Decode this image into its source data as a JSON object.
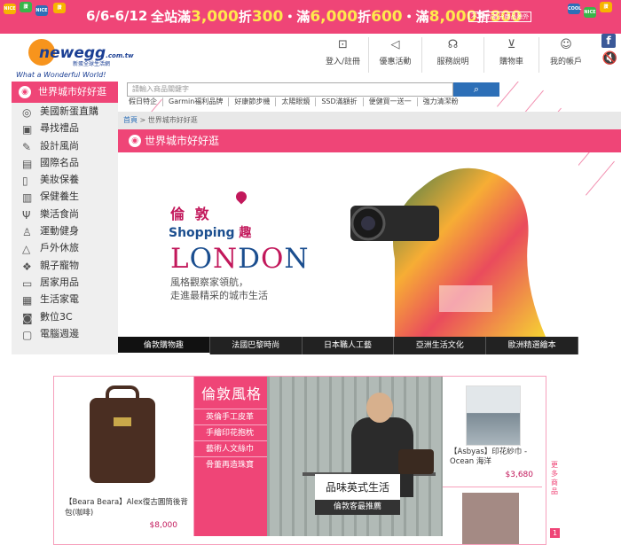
{
  "promo": {
    "dates": "6/6-6/12",
    "main_prefix_1": "全站滿",
    "amt1": "3,000",
    "off1_mid": "折",
    "off1": "300",
    "sep": "・滿",
    "amt2": "6,000",
    "off2_mid": "折",
    "off2": "600",
    "sep2": "・滿",
    "amt3": "8,000",
    "off3_mid": "折",
    "off3": "800",
    "note": "不累折/部分商品除外",
    "badges": [
      "NICE",
      "讚",
      "NICE",
      "讚",
      "COOL",
      "NICE",
      "讚"
    ]
  },
  "logo": {
    "text": "newegg",
    "domain": ".com.tw",
    "sub": "新蛋全球生活網",
    "slogan": "What a Wonderful World!"
  },
  "header_nav": [
    {
      "label": "登入/註冊",
      "icon": "login-icon",
      "glyph": "⊡"
    },
    {
      "label": "優惠活動",
      "icon": "megaphone-icon",
      "glyph": "◁"
    },
    {
      "label": "服務說明",
      "icon": "headset-icon",
      "glyph": "☊"
    },
    {
      "label": "購物車",
      "icon": "cart-icon",
      "glyph": "⊻"
    },
    {
      "label": "我的帳戶",
      "icon": "account-icon",
      "glyph": "☺"
    }
  ],
  "social": {
    "facebook": "f",
    "sound": "🔇"
  },
  "sidebar": {
    "header": "世界城市好好逛",
    "items": [
      {
        "label": "美國新蛋直購",
        "icon": "globe-icon",
        "glyph": "◎"
      },
      {
        "label": "尋找禮品",
        "icon": "gift-icon",
        "glyph": "▣"
      },
      {
        "label": "設計風尚",
        "icon": "pencil-icon",
        "glyph": "✎"
      },
      {
        "label": "國際名品",
        "icon": "badge-icon",
        "glyph": "▤"
      },
      {
        "label": "美妝保養",
        "icon": "cosmetics-icon",
        "glyph": "▯"
      },
      {
        "label": "保健養生",
        "icon": "health-icon",
        "glyph": "▥"
      },
      {
        "label": "樂活食尚",
        "icon": "fork-icon",
        "glyph": "Ψ"
      },
      {
        "label": "運動健身",
        "icon": "run-icon",
        "glyph": "♙"
      },
      {
        "label": "戶外休旅",
        "icon": "tent-icon",
        "glyph": "△"
      },
      {
        "label": "親子寵物",
        "icon": "paw-icon",
        "glyph": "❖"
      },
      {
        "label": "居家用品",
        "icon": "sofa-icon",
        "glyph": "▭"
      },
      {
        "label": "生活家電",
        "icon": "appliance-icon",
        "glyph": "▦"
      },
      {
        "label": "數位3C",
        "icon": "camera-icon",
        "glyph": "◙"
      },
      {
        "label": "電腦週邊",
        "icon": "monitor-icon",
        "glyph": "▢"
      }
    ]
  },
  "search": {
    "placeholder": "請輸入商品關鍵字",
    "button_icon": "search-icon",
    "button_glyph": "⌕"
  },
  "quicklinks": [
    "假日特企",
    "Garmin福利品牌",
    "好康節步機",
    "太陽眼鏡",
    "SSD滿額折",
    "便健買一送一",
    "強力清潔粉"
  ],
  "breadcrumb": {
    "home": "首頁",
    "sep": ">",
    "current": "世界城市好好逛"
  },
  "page_title": "世界城市好好逛",
  "banner": {
    "city": "倫 敦",
    "shopping": "Shopping",
    "qu": "趣",
    "london": "LONDON",
    "line1": "風格觀察家領航，",
    "line2": "走進最精采的城市生活"
  },
  "tabs": [
    "倫敦購物趣",
    "法國巴黎時尚",
    "日本職人工藝",
    "亞洲生活文化",
    "歐洲精選繪本"
  ],
  "product_left": {
    "name": "【Beara Beara】Alex復古圓筒後背包(咖啡)",
    "price": "$8,000"
  },
  "style_list": {
    "title": "倫敦風格",
    "items": [
      "英倫手工皮革",
      "手繪印花抱枕",
      "藝術人文絲巾",
      "骨董再造珠寶"
    ]
  },
  "feature": {
    "caption": "品味英式生活",
    "sub": "倫敦客最推薦"
  },
  "product_right": {
    "name": "【Asbyas】印花紗巾 - Ocean 海洋",
    "price": "$3,680"
  },
  "side_more": {
    "label": "更多商品",
    "badge": "1"
  }
}
